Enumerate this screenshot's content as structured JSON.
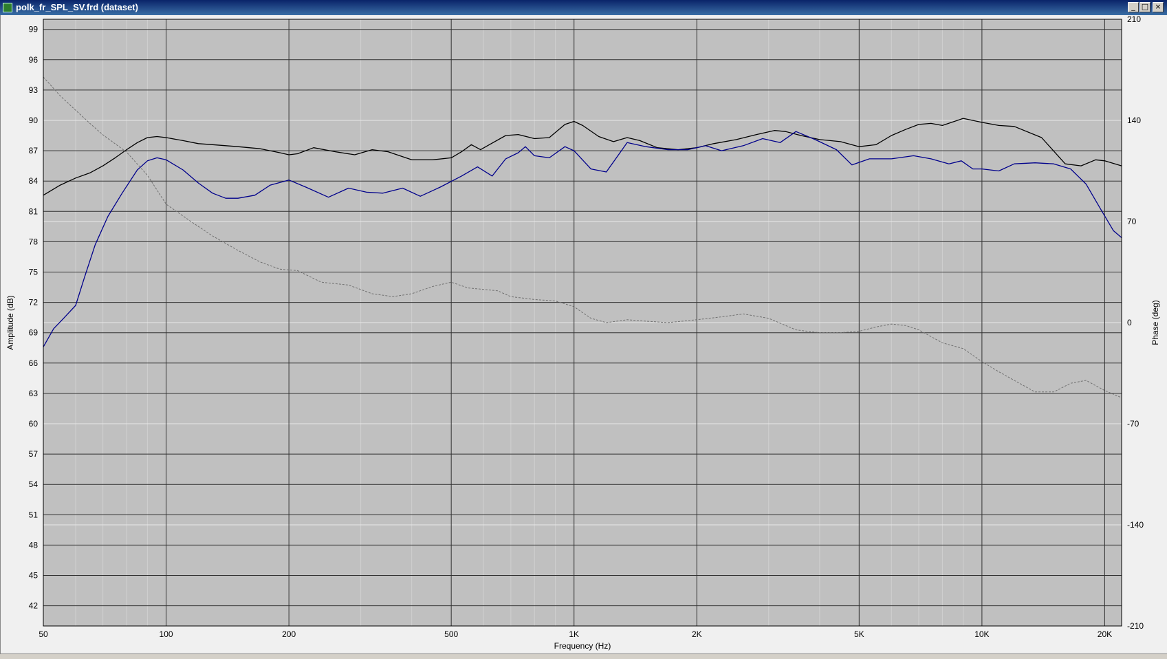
{
  "window": {
    "title": "polk_fr_SPL_SV.frd (dataset)",
    "minimize_glyph": "_",
    "maximize_glyph": "□",
    "close_glyph": "×"
  },
  "chart_data": {
    "type": "line",
    "title": "",
    "xlabel": "Frequency (Hz)",
    "ylabel": "Amplitude (dB)",
    "y2label": "Phase (deg)",
    "x_scale": "log",
    "xlim": [
      50,
      22000
    ],
    "ylim": [
      40,
      100
    ],
    "y2lim": [
      -210,
      210
    ],
    "grid": true,
    "plot_background": "#c0c0c0",
    "x_major_ticks": [
      50,
      100,
      200,
      500,
      1000,
      2000,
      5000,
      10000,
      20000
    ],
    "x_tick_labels": [
      "50",
      "100",
      "200",
      "500",
      "1K",
      "2K",
      "5K",
      "10K",
      "20K"
    ],
    "y_ticks": [
      42,
      45,
      48,
      51,
      54,
      57,
      60,
      63,
      66,
      69,
      72,
      75,
      78,
      81,
      84,
      87,
      90,
      93,
      96,
      99
    ],
    "y_tick_labels": [
      "42",
      "45",
      "48",
      "51",
      "54",
      "57",
      "60",
      "63",
      "66",
      "69",
      "72",
      "75",
      "78",
      "81",
      "84",
      "87",
      "90",
      "93",
      "96",
      "99"
    ],
    "y2_ticks": [
      210,
      140,
      70,
      0,
      -70,
      -140,
      -210
    ],
    "y2_tick_labels": [
      "210",
      "140",
      "70",
      "0",
      "-70",
      "-140",
      "-210"
    ],
    "series": [
      {
        "color": "#000000",
        "axis": "left",
        "style": "solid",
        "points": [
          [
            50,
            82.6
          ],
          [
            55,
            83.6
          ],
          [
            60,
            84.3
          ],
          [
            65,
            84.8
          ],
          [
            70,
            85.5
          ],
          [
            75,
            86.3
          ],
          [
            80,
            87.1
          ],
          [
            85,
            87.8
          ],
          [
            90,
            88.3
          ],
          [
            95,
            88.4
          ],
          [
            100,
            88.3
          ],
          [
            110,
            88.0
          ],
          [
            120,
            87.7
          ],
          [
            130,
            87.6
          ],
          [
            150,
            87.4
          ],
          [
            170,
            87.2
          ],
          [
            190,
            86.8
          ],
          [
            200,
            86.6
          ],
          [
            210,
            86.7
          ],
          [
            230,
            87.3
          ],
          [
            260,
            86.9
          ],
          [
            290,
            86.6
          ],
          [
            320,
            87.1
          ],
          [
            350,
            86.9
          ],
          [
            400,
            86.1
          ],
          [
            450,
            86.1
          ],
          [
            500,
            86.3
          ],
          [
            530,
            86.9
          ],
          [
            560,
            87.6
          ],
          [
            590,
            87.1
          ],
          [
            620,
            87.6
          ],
          [
            680,
            88.5
          ],
          [
            730,
            88.6
          ],
          [
            800,
            88.2
          ],
          [
            870,
            88.3
          ],
          [
            950,
            89.6
          ],
          [
            1000,
            89.9
          ],
          [
            1050,
            89.5
          ],
          [
            1150,
            88.4
          ],
          [
            1250,
            87.9
          ],
          [
            1350,
            88.3
          ],
          [
            1450,
            88.0
          ],
          [
            1600,
            87.3
          ],
          [
            1800,
            87.1
          ],
          [
            2000,
            87.3
          ],
          [
            2200,
            87.7
          ],
          [
            2500,
            88.1
          ],
          [
            2800,
            88.6
          ],
          [
            3100,
            89.0
          ],
          [
            3300,
            88.9
          ],
          [
            3600,
            88.5
          ],
          [
            4000,
            88.1
          ],
          [
            4500,
            87.9
          ],
          [
            5000,
            87.4
          ],
          [
            5500,
            87.6
          ],
          [
            6000,
            88.5
          ],
          [
            6500,
            89.1
          ],
          [
            7000,
            89.6
          ],
          [
            7500,
            89.7
          ],
          [
            8000,
            89.5
          ],
          [
            9000,
            90.2
          ],
          [
            10000,
            89.8
          ],
          [
            11000,
            89.5
          ],
          [
            12000,
            89.4
          ],
          [
            14000,
            88.3
          ],
          [
            16000,
            85.7
          ],
          [
            17500,
            85.5
          ],
          [
            19000,
            86.1
          ],
          [
            20000,
            86.0
          ],
          [
            22000,
            85.5
          ]
        ]
      },
      {
        "color": "#00008b",
        "axis": "left",
        "style": "solid",
        "points": [
          [
            50,
            67.6
          ],
          [
            53,
            69.4
          ],
          [
            56,
            70.4
          ],
          [
            60,
            71.7
          ],
          [
            63,
            74.4
          ],
          [
            67,
            77.7
          ],
          [
            72,
            80.5
          ],
          [
            78,
            82.8
          ],
          [
            85,
            85.1
          ],
          [
            90,
            86.0
          ],
          [
            95,
            86.3
          ],
          [
            100,
            86.1
          ],
          [
            110,
            85.1
          ],
          [
            120,
            83.8
          ],
          [
            130,
            82.8
          ],
          [
            140,
            82.3
          ],
          [
            150,
            82.3
          ],
          [
            165,
            82.6
          ],
          [
            180,
            83.6
          ],
          [
            200,
            84.1
          ],
          [
            220,
            83.4
          ],
          [
            250,
            82.4
          ],
          [
            280,
            83.3
          ],
          [
            310,
            82.9
          ],
          [
            340,
            82.8
          ],
          [
            380,
            83.3
          ],
          [
            420,
            82.5
          ],
          [
            470,
            83.4
          ],
          [
            530,
            84.5
          ],
          [
            580,
            85.4
          ],
          [
            630,
            84.5
          ],
          [
            680,
            86.2
          ],
          [
            730,
            86.8
          ],
          [
            760,
            87.4
          ],
          [
            800,
            86.5
          ],
          [
            870,
            86.3
          ],
          [
            950,
            87.4
          ],
          [
            1000,
            87.0
          ],
          [
            1100,
            85.2
          ],
          [
            1200,
            84.9
          ],
          [
            1350,
            87.8
          ],
          [
            1500,
            87.4
          ],
          [
            1700,
            87.1
          ],
          [
            1900,
            87.1
          ],
          [
            2100,
            87.5
          ],
          [
            2300,
            87.0
          ],
          [
            2600,
            87.5
          ],
          [
            2900,
            88.2
          ],
          [
            3200,
            87.8
          ],
          [
            3500,
            88.9
          ],
          [
            3900,
            88.1
          ],
          [
            4400,
            87.1
          ],
          [
            4800,
            85.6
          ],
          [
            5300,
            86.2
          ],
          [
            6000,
            86.2
          ],
          [
            6800,
            86.5
          ],
          [
            7500,
            86.2
          ],
          [
            8300,
            85.7
          ],
          [
            8900,
            86.0
          ],
          [
            9500,
            85.2
          ],
          [
            10000,
            85.2
          ],
          [
            11000,
            85.0
          ],
          [
            12000,
            85.7
          ],
          [
            13500,
            85.8
          ],
          [
            15000,
            85.7
          ],
          [
            16500,
            85.2
          ],
          [
            18000,
            83.7
          ],
          [
            19500,
            81.3
          ],
          [
            21000,
            79.1
          ],
          [
            22000,
            78.4
          ]
        ]
      },
      {
        "color": "#707070",
        "axis": "right",
        "style": "dashed",
        "points": [
          [
            50,
            170
          ],
          [
            55,
            157
          ],
          [
            60,
            147
          ],
          [
            65,
            138
          ],
          [
            70,
            130
          ],
          [
            80,
            118
          ],
          [
            90,
            102
          ],
          [
            100,
            82
          ],
          [
            115,
            70
          ],
          [
            130,
            60
          ],
          [
            150,
            50
          ],
          [
            170,
            42
          ],
          [
            190,
            37
          ],
          [
            210,
            36
          ],
          [
            240,
            28
          ],
          [
            280,
            26
          ],
          [
            320,
            20
          ],
          [
            360,
            18
          ],
          [
            400,
            20
          ],
          [
            450,
            25
          ],
          [
            500,
            28
          ],
          [
            550,
            24
          ],
          [
            600,
            23
          ],
          [
            650,
            22
          ],
          [
            700,
            18
          ],
          [
            800,
            16
          ],
          [
            900,
            15
          ],
          [
            1000,
            11
          ],
          [
            1100,
            3
          ],
          [
            1200,
            0
          ],
          [
            1350,
            2
          ],
          [
            1500,
            1
          ],
          [
            1700,
            0
          ],
          [
            2000,
            2
          ],
          [
            2300,
            4
          ],
          [
            2600,
            6
          ],
          [
            3000,
            3
          ],
          [
            3500,
            -5
          ],
          [
            4000,
            -7
          ],
          [
            4500,
            -7
          ],
          [
            5000,
            -6
          ],
          [
            5500,
            -3
          ],
          [
            6000,
            -1
          ],
          [
            6500,
            -2
          ],
          [
            7000,
            -5
          ],
          [
            8000,
            -14
          ],
          [
            9000,
            -18
          ],
          [
            10000,
            -27
          ],
          [
            11000,
            -34
          ],
          [
            12000,
            -40
          ],
          [
            13500,
            -48
          ],
          [
            15000,
            -48
          ],
          [
            16500,
            -42
          ],
          [
            18000,
            -40
          ],
          [
            20000,
            -47
          ],
          [
            22000,
            -52
          ]
        ]
      }
    ]
  }
}
